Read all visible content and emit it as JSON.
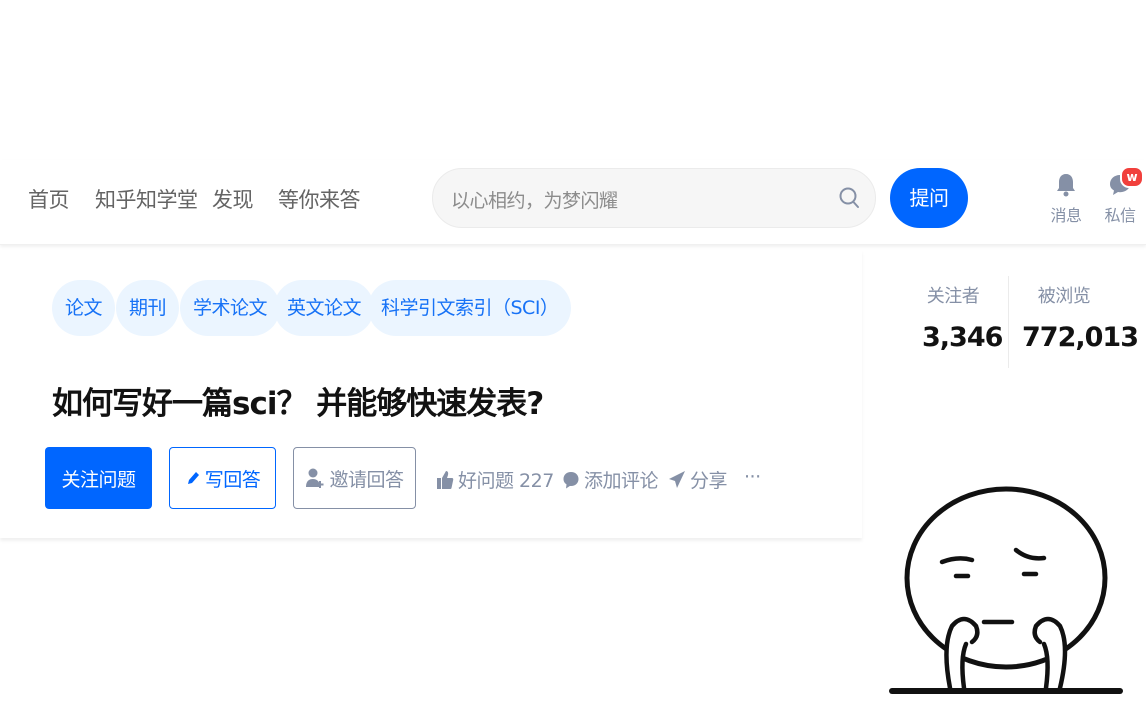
{
  "nav": {
    "items": [
      "首页",
      "知乎知学堂",
      "发现",
      "等你来答"
    ],
    "search_placeholder": "以心相约，为梦闪耀",
    "ask_label": "提问",
    "messages_label": "消息",
    "dm_label": "私信",
    "dm_badge": "w"
  },
  "question": {
    "topics": [
      "论文",
      "期刊",
      "学术论文",
      "英文论文",
      "科学引文索引（SCI）"
    ],
    "title": "如何写好一篇sci？ 并能够快速发表?",
    "follow_label": "关注问题",
    "write_answer_label": "写回答",
    "invite_label": "邀请回答",
    "good_question_label": "好问题 227",
    "comment_label": "添加评论",
    "share_label": "分享",
    "more_label": "···"
  },
  "stats": {
    "followers_label": "关注者",
    "followers_value": "3,346",
    "views_label": "被浏览",
    "views_value": "772,013"
  },
  "colors": {
    "brand_blue": "#0066ff",
    "topic_bg": "#ebf5ff",
    "topic_text": "#1772f6",
    "muted_text": "#8590a6",
    "badge_red": "#f1403c"
  },
  "icons": [
    "search-icon",
    "bell-icon",
    "chat-bubble-icon",
    "pencil-icon",
    "add-user-icon",
    "thumbs-up-icon",
    "comment-icon",
    "share-arrow-icon"
  ]
}
